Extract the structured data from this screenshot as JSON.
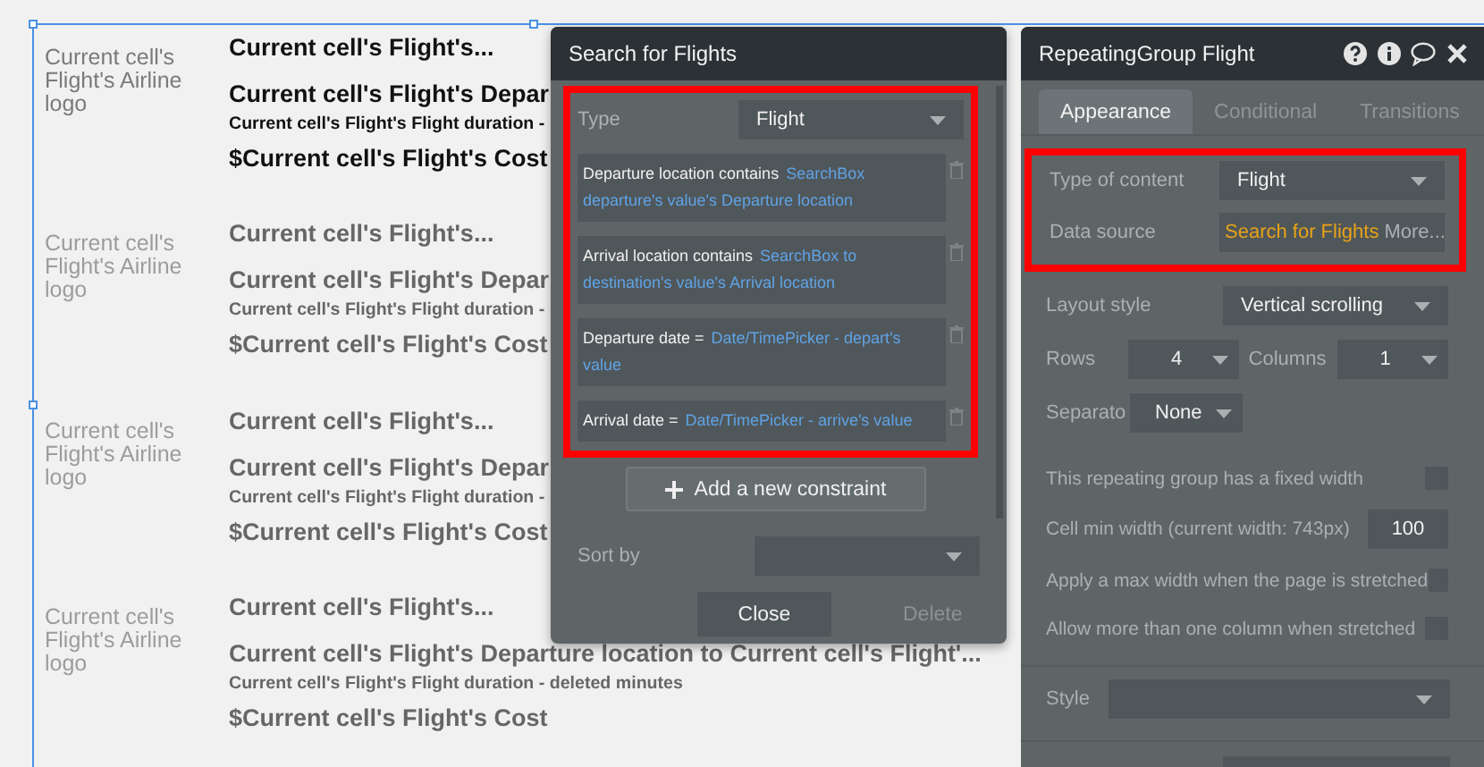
{
  "canvas": {
    "cells": [
      {
        "logo": "Current cell's Flight's Airline logo",
        "title": "Current cell's Flight's...",
        "route": "Current cell's Flight's Depar",
        "duration": "Current cell's Flight's Flight duration -",
        "cost": "$Current cell's Flight's Cost",
        "faded": false
      },
      {
        "logo": "Current cell's Flight's Airline logo",
        "title": "Current cell's Flight's...",
        "route": "Current cell's Flight's Depar",
        "duration": "Current cell's Flight's Flight duration -",
        "cost": "$Current cell's Flight's Cost",
        "faded": true
      },
      {
        "logo": "Current cell's Flight's Airline logo",
        "title": "Current cell's Flight's...",
        "route": "Current cell's Flight's Depar",
        "duration": "Current cell's Flight's Flight duration -",
        "cost": "$Current cell's Flight's Cost",
        "faded": true
      },
      {
        "logo": "Current cell's Flight's Airline logo",
        "title": "Current cell's Flight's...",
        "route": "Current cell's Flight's Departure location to Current cell's Flight'...",
        "duration": "Current cell's Flight's Flight duration - deleted minutes",
        "cost": "$Current cell's Flight's Cost",
        "faded": true
      }
    ]
  },
  "search_panel": {
    "title": "Search for Flights",
    "type_label": "Type",
    "type_value": "Flight",
    "constraints": [
      {
        "label": "Departure location contains",
        "value": "SearchBox departure's value's Departure location"
      },
      {
        "label": "Arrival location contains",
        "value": "SearchBox to destination's value's Arrival location"
      },
      {
        "label": "Departure date =",
        "value": "Date/TimePicker - depart's value"
      },
      {
        "label": "Arrival date =",
        "value": "Date/TimePicker - arrive's value"
      }
    ],
    "add_button": "Add a new constraint",
    "sort_label": "Sort by",
    "buttons": [
      {
        "label": "Close",
        "disabled": false
      },
      {
        "label": "Delete",
        "disabled": true
      }
    ]
  },
  "property_panel": {
    "title": "RepeatingGroup Flight",
    "tabs": [
      {
        "label": "Appearance",
        "selected": true
      },
      {
        "label": "Conditional",
        "selected": false
      },
      {
        "label": "Transitions",
        "selected": false
      }
    ],
    "type_of_content": {
      "label": "Type of content",
      "value": "Flight"
    },
    "data_source": {
      "label": "Data source",
      "value": "Search for Flights",
      "more": "More..."
    },
    "layout_style": {
      "label": "Layout style",
      "value": "Vertical scrolling"
    },
    "rows": {
      "label": "Rows",
      "value": "4"
    },
    "columns": {
      "label": "Columns",
      "value": "1"
    },
    "separator": {
      "label": "Separato",
      "value": "None"
    },
    "options": [
      {
        "kind": "checkbox",
        "label": "This repeating group has a fixed width",
        "checked": false
      },
      {
        "kind": "number",
        "label": "Cell min width (current width: 743px)",
        "value": "100"
      },
      {
        "kind": "checkbox",
        "label": "Apply a max width when the page is stretched",
        "checked": false
      },
      {
        "kind": "checkbox",
        "label": "Allow more than one column when stretched",
        "checked": false
      }
    ],
    "style_label": "Style"
  }
}
